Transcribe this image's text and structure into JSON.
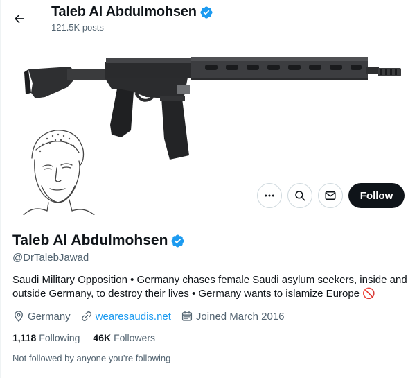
{
  "header": {
    "name": "Taleb Al Abdulmohsen",
    "posts": "121.5K posts"
  },
  "profile": {
    "name": "Taleb Al Abdulmohsen",
    "handle": "@DrTalebJawad",
    "bio": "Saudi Military Opposition • Germany chases female Saudi asylum seekers, inside and outside Germany, to destroy their lives • Germany wants to islamize Europe",
    "bio_emoji": "🚫",
    "location": "Germany",
    "website": "wearesaudis.net",
    "joined": "Joined March 2016",
    "following_count": "1,118",
    "following_label": "Following",
    "followers_count": "46K",
    "followers_label": "Followers",
    "not_followed_text": "Not followed by anyone you’re following"
  },
  "actions": {
    "follow_label": "Follow",
    "icons": [
      "more-icon",
      "search-icon",
      "mail-icon"
    ]
  },
  "colors": {
    "verified": "#1d9bf0",
    "link": "#1d9bf0",
    "follow_button_bg": "#0f1419",
    "secondary_text": "#536471"
  }
}
